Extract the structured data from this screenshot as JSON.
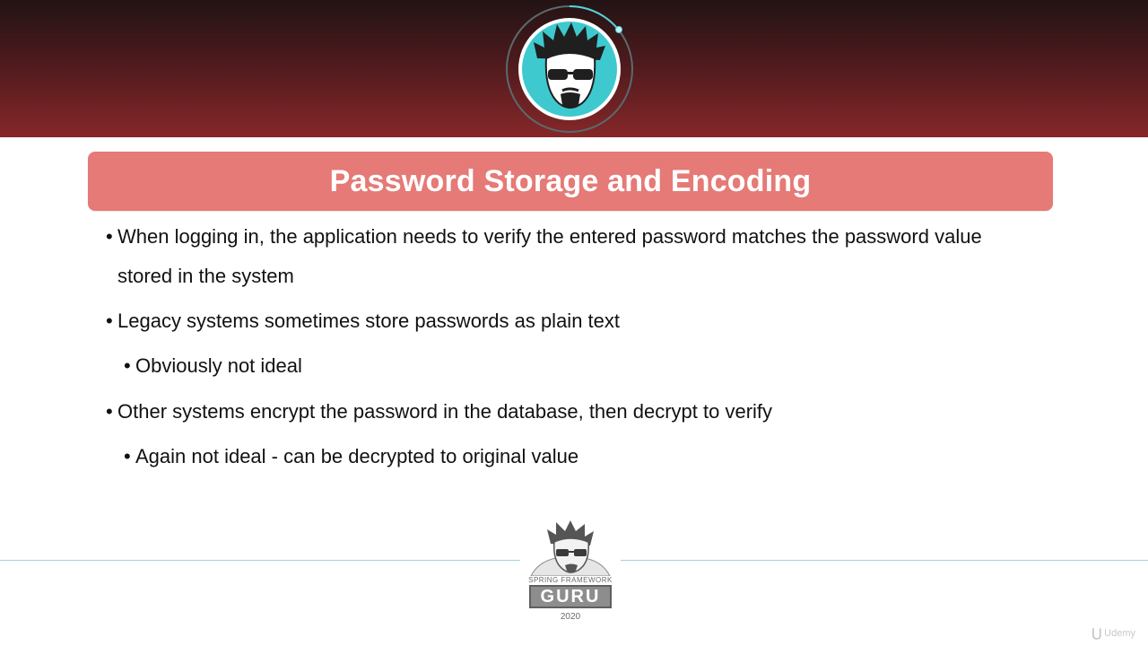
{
  "slide": {
    "title": "Password Storage and Encoding",
    "bullets": [
      {
        "level": 1,
        "text": "When logging in, the application needs to verify the entered password matches the password value stored in the system"
      },
      {
        "level": 1,
        "text": "Legacy systems sometimes store passwords as plain text"
      },
      {
        "level": 2,
        "text": "Obviously not ideal"
      },
      {
        "level": 1,
        "text": "Other systems encrypt the password in the database, then decrypt to verify"
      },
      {
        "level": 2,
        "text": "Again not ideal - can be decrypted to original value"
      }
    ],
    "bullet_glyph": "•"
  },
  "footer_logo": {
    "caption": "SPRING FRAMEWORK",
    "word": "GURU",
    "year": "2020"
  },
  "watermark": {
    "text": "Udemy"
  },
  "colors": {
    "header_dark": "#221314",
    "header_red": "#862729",
    "title_bar": "#e57a76",
    "avatar_teal": "#3ec9cf",
    "divider": "#a8cfe6"
  }
}
